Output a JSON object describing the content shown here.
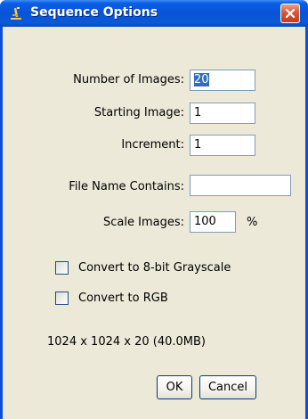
{
  "window": {
    "title": "Sequence Options",
    "app_icon": "imagej-microscope-icon",
    "close_icon": "close-icon",
    "close_color": "#d8583a",
    "titlebar_color": "#0a5ad8"
  },
  "form": {
    "number_of_images": {
      "label": "Number of Images:",
      "value": "20"
    },
    "starting_image": {
      "label": "Starting Image:",
      "value": "1"
    },
    "increment": {
      "label": "Increment:",
      "value": "1"
    },
    "file_name_contains": {
      "label": "File Name Contains:",
      "value": ""
    },
    "scale_images": {
      "label": "Scale Images:",
      "value": "100",
      "unit": "%"
    }
  },
  "options": {
    "grayscale": {
      "label": "Convert to 8-bit Grayscale",
      "checked": false
    },
    "rgb": {
      "label": "Convert to RGB",
      "checked": false
    }
  },
  "info_text": "1024 x 1024 x 20 (40.0MB)",
  "buttons": {
    "ok": "OK",
    "cancel": "Cancel"
  }
}
